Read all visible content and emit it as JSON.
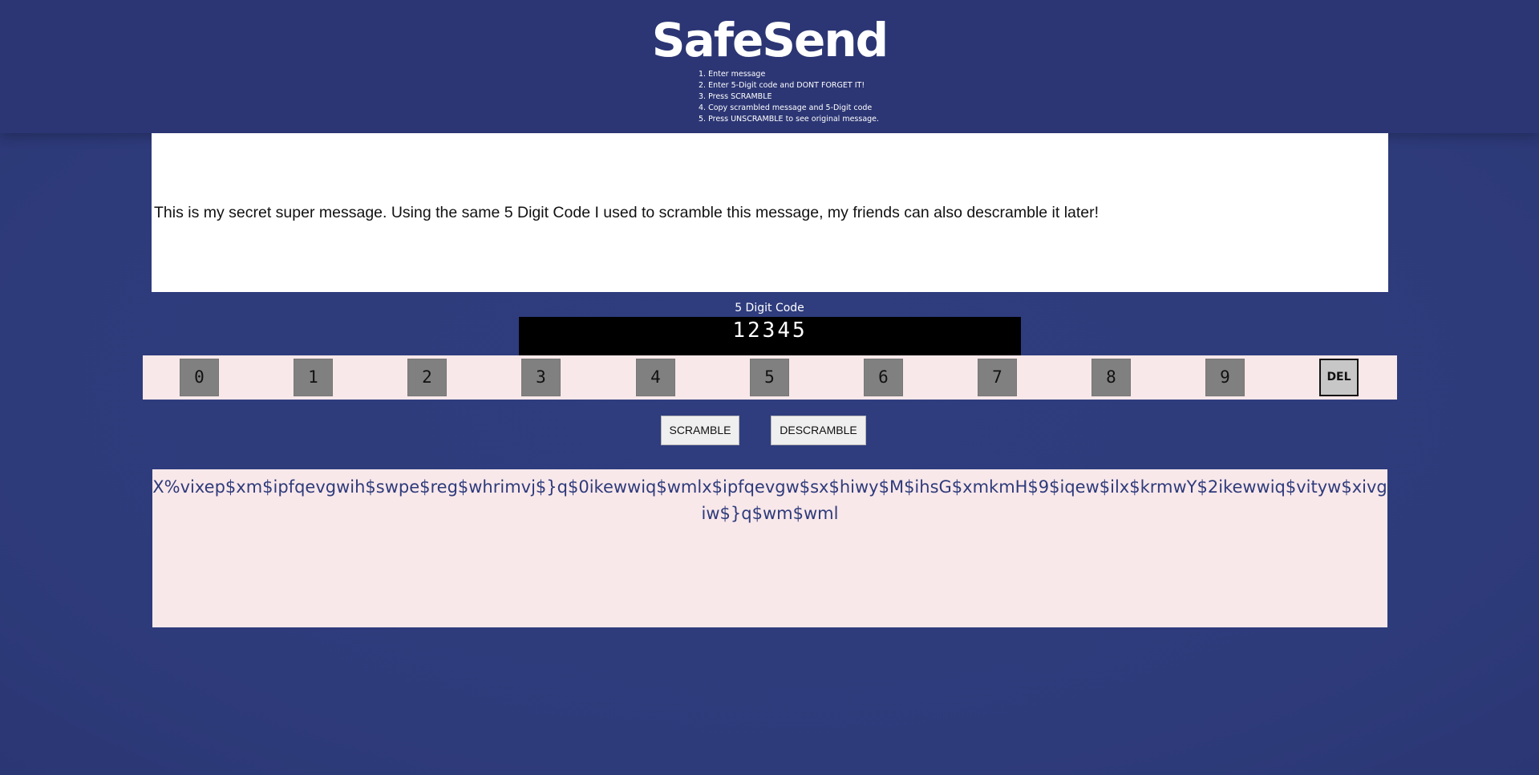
{
  "app": {
    "title": "SafeSend",
    "instructions": [
      "1. Enter message",
      "2. Enter 5-Digit code and DONT FORGET IT!",
      "3. Press SCRAMBLE",
      "4. Copy scrambled message and 5-Digit code",
      "5. Press UNSCRAMBLE to see original message."
    ]
  },
  "message": {
    "value": "This is my secret super message. Using the same 5 Digit Code I used to scramble this message, my friends can also descramble it later!"
  },
  "code": {
    "label": "5 Digit Code",
    "value": "12345"
  },
  "keypad": {
    "keys": [
      "0",
      "1",
      "2",
      "3",
      "4",
      "5",
      "6",
      "7",
      "8",
      "9"
    ],
    "delete_label": "DEL"
  },
  "actions": {
    "scramble_label": "SCRAMBLE",
    "descramble_label": "DESCRAMBLE"
  },
  "output": {
    "value": "X%vixep$xm$ipfqevgwih$swpe$reg$whrimvj$}q$0ikewwiq$wmlx$ipfqevgw$sx$hiwy$M$ihsG$xmkmH$9$iqew$ilx$krmwY$2ikewwiq$vityw$xivgiw$}q$wm$wml"
  },
  "colors": {
    "background": "#2e3b7b",
    "header": "#2c3674",
    "keypad_bg": "#f9e8ea",
    "key_bg": "#808080",
    "output_text": "#2e3b7b"
  }
}
